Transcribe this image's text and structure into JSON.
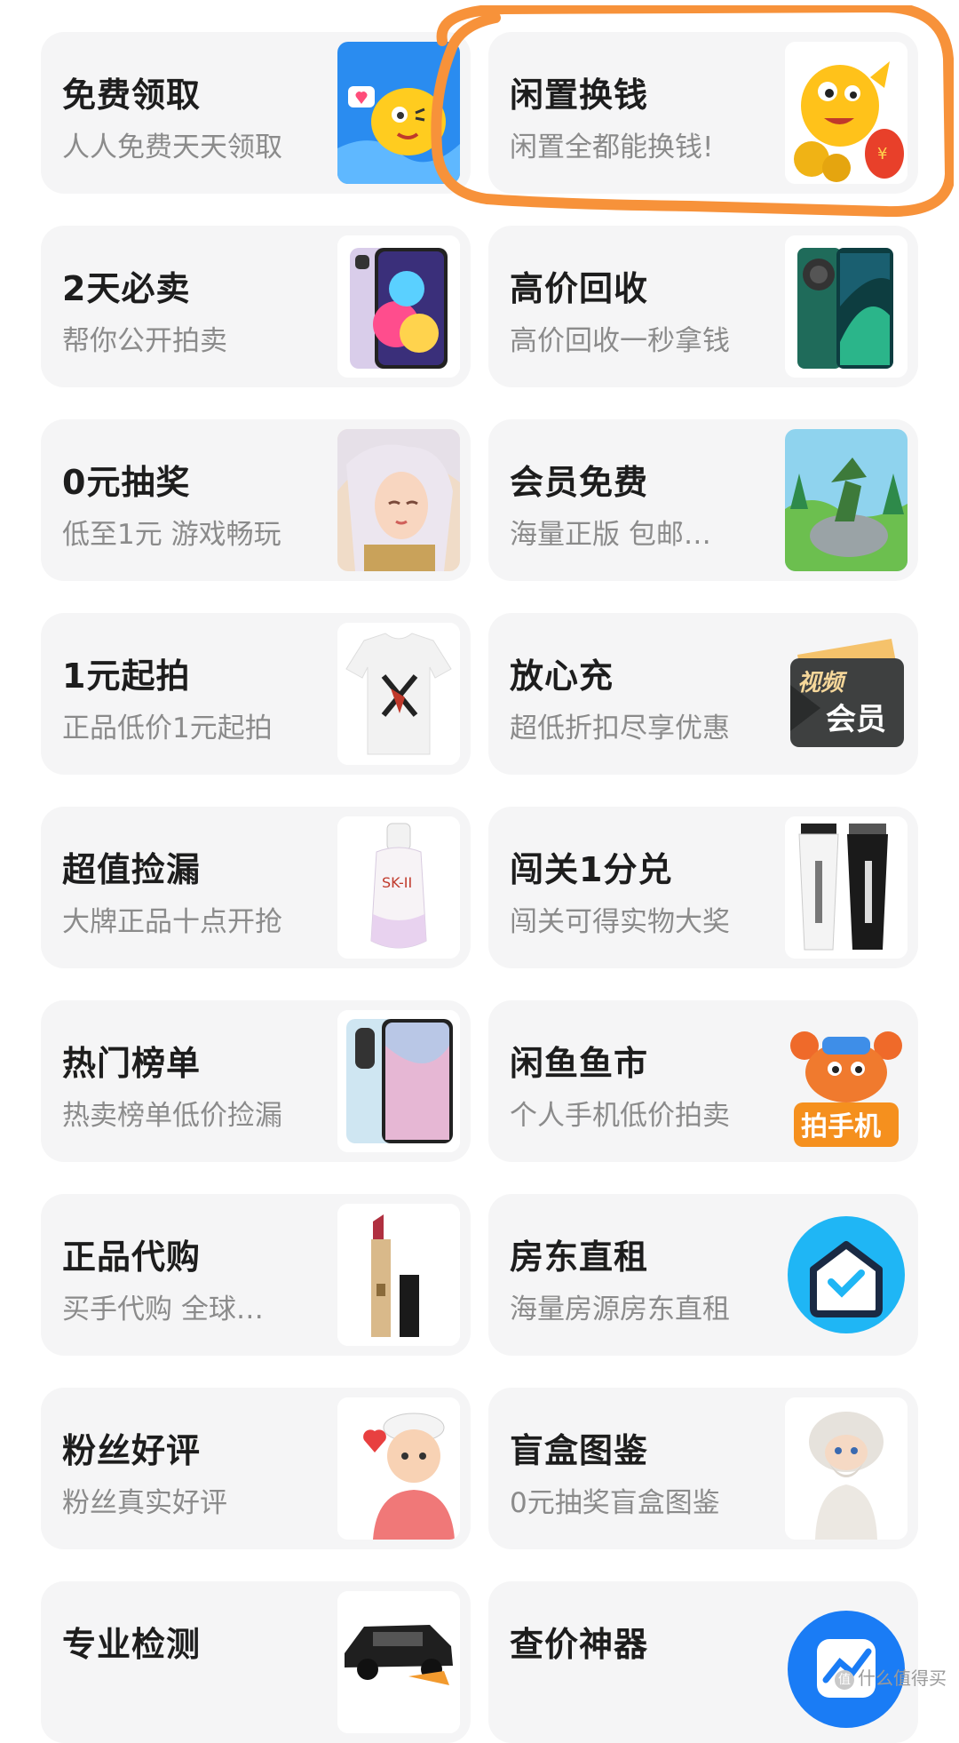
{
  "cards": [
    {
      "title": "免费领取",
      "subtitle": "人人免费天天领取",
      "image": "fish-mascot-with-heart"
    },
    {
      "title": "闲置换钱",
      "subtitle": "闲置全都能换钱!",
      "image": "fish-mascot-with-coins"
    },
    {
      "title": "2天必卖",
      "subtitle": "帮你公开拍卖",
      "image": "purple-iphone"
    },
    {
      "title": "高价回收",
      "subtitle": "高价回收一秒拿钱",
      "image": "green-huawei-phone"
    },
    {
      "title": "0元抽奖",
      "subtitle": "低至1元 游戏畅玩",
      "image": "game-character-portrait"
    },
    {
      "title": "会员免费",
      "subtitle": "海量正版 包邮…",
      "image": "moomin-illustration"
    },
    {
      "title": "1元起拍",
      "subtitle": "正品低价1元起拍",
      "image": "white-tshirt"
    },
    {
      "title": "放心充",
      "subtitle": "超低折扣尽享优惠",
      "image": "video-vip-card",
      "image_text": {
        "top": "视频",
        "bottom": "会员"
      }
    },
    {
      "title": "超值捡漏",
      "subtitle": "大牌正品十点开抢",
      "image": "skii-serum-bottle",
      "image_text": {
        "brand": "SK-II"
      }
    },
    {
      "title": "闯关1分兑",
      "subtitle": "闯关可得实物大奖",
      "image": "zoo-son-tubes"
    },
    {
      "title": "热门榜单",
      "subtitle": "热卖榜单低价捡漏",
      "image": "vivo-phone"
    },
    {
      "title": "闲鱼鱼市",
      "subtitle": "个人手机低价拍卖",
      "image": "crab-mascot-sign",
      "image_text": {
        "sign": "拍手机"
      }
    },
    {
      "title": "正品代购",
      "subtitle": "买手代购 全球…",
      "image": "ysl-lipstick"
    },
    {
      "title": "房东直租",
      "subtitle": "海量房源房东直租",
      "image": "house-check-icon"
    },
    {
      "title": "粉丝好评",
      "subtitle": "粉丝真实好评",
      "image": "cartoon-boy-heart"
    },
    {
      "title": "盲盒图鉴",
      "subtitle": "0元抽奖盲盒图鉴",
      "image": "blind-box-figure"
    },
    {
      "title": "专业检测",
      "subtitle": "",
      "image": "black-suv"
    },
    {
      "title": "查价神器",
      "subtitle": "",
      "image": "price-chart-icon"
    }
  ],
  "watermark": "什么值得买",
  "colors": {
    "card_bg": "#f5f5f6",
    "highlight": "#f7923a",
    "title": "#1d1d1d",
    "subtitle": "#8b8b8b"
  }
}
